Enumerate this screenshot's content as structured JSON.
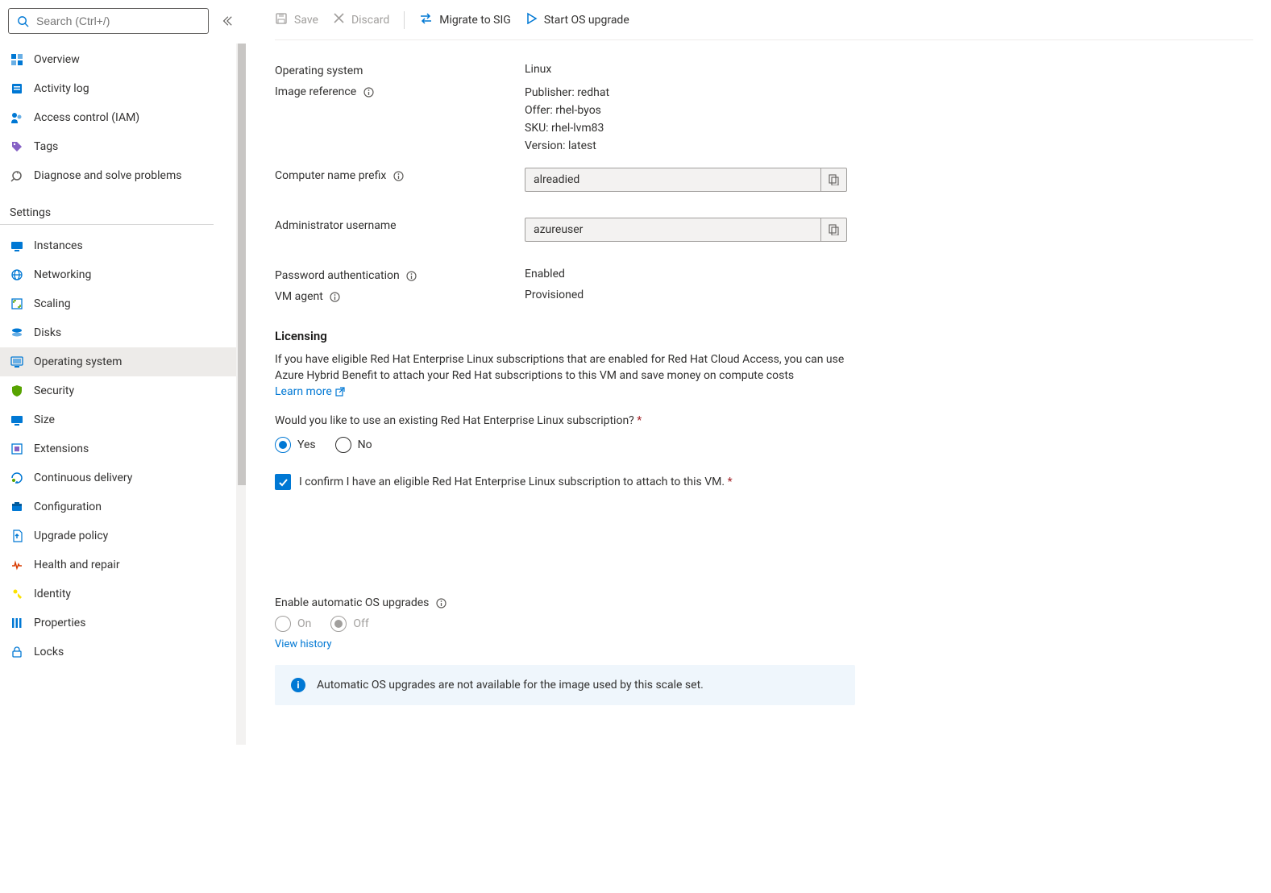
{
  "search": {
    "placeholder": "Search (Ctrl+/)"
  },
  "nav": {
    "top": [
      {
        "label": "Overview"
      },
      {
        "label": "Activity log"
      },
      {
        "label": "Access control (IAM)"
      },
      {
        "label": "Tags"
      },
      {
        "label": "Diagnose and solve problems"
      }
    ],
    "sectionHeader": "Settings",
    "settings": [
      {
        "label": "Instances"
      },
      {
        "label": "Networking"
      },
      {
        "label": "Scaling"
      },
      {
        "label": "Disks"
      },
      {
        "label": "Operating system"
      },
      {
        "label": "Security"
      },
      {
        "label": "Size"
      },
      {
        "label": "Extensions"
      },
      {
        "label": "Continuous delivery"
      },
      {
        "label": "Configuration"
      },
      {
        "label": "Upgrade policy"
      },
      {
        "label": "Health and repair"
      },
      {
        "label": "Identity"
      },
      {
        "label": "Properties"
      },
      {
        "label": "Locks"
      }
    ]
  },
  "cmd": {
    "save": "Save",
    "discard": "Discard",
    "migrate": "Migrate to SIG",
    "upgrade": "Start OS upgrade"
  },
  "fields": {
    "os_label": "Operating system",
    "os_value": "Linux",
    "imgref_label": "Image reference",
    "imgref_lines": {
      "publisher": "Publisher: redhat",
      "offer": "Offer: rhel-byos",
      "sku": "SKU: rhel-lvm83",
      "version": "Version: latest"
    },
    "prefix_label": "Computer name prefix",
    "prefix_value": "alreadied",
    "admin_label": "Administrator username",
    "admin_value": "azureuser",
    "pwauth_label": "Password authentication",
    "pwauth_value": "Enabled",
    "vmagent_label": "VM agent",
    "vmagent_value": "Provisioned"
  },
  "licensing": {
    "heading": "Licensing",
    "blurb": "If you have eligible Red Hat Enterprise Linux subscriptions that are enabled for Red Hat Cloud Access, you can use Azure Hybrid Benefit to attach your Red Hat subscriptions to this VM and save money on compute costs",
    "learn_more": "Learn more",
    "question": "Would you like to use an existing Red Hat Enterprise Linux subscription?",
    "yes": "Yes",
    "no": "No",
    "confirm": "I confirm I have an eligible Red Hat Enterprise Linux subscription to attach to this VM."
  },
  "autoUpgrade": {
    "label": "Enable automatic OS upgrades",
    "on": "On",
    "off": "Off",
    "history_link": "View history",
    "info": "Automatic OS upgrades are not available for the image used by this scale set."
  }
}
